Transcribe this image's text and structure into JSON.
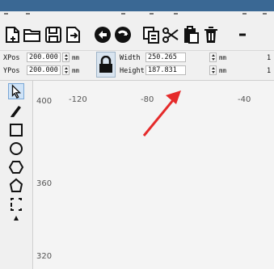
{
  "props": {
    "xpos_label": "XPos",
    "xpos_value": "200.000",
    "ypos_label": "YPos",
    "ypos_value": "200.000",
    "unit_mm": "mm",
    "width_label": "Width",
    "width_value": "250.265",
    "height_label": "Height",
    "height_value": "187.831",
    "right_cut_1": "1",
    "right_cut_2": "1"
  },
  "toolbar": {
    "buttons": [
      "new-file",
      "open-folder",
      "save",
      "import",
      "prev-circle",
      "next-circle",
      "copy",
      "cut",
      "paste",
      "delete"
    ]
  },
  "left_tools": [
    "select-arrow",
    "pen",
    "rectangle",
    "ellipse",
    "hexagon",
    "polygon",
    "text-frame"
  ],
  "canvas": {
    "ruler_x": [
      "-120",
      "-80",
      "-40"
    ],
    "ruler_y": [
      "400",
      "360",
      "320"
    ]
  },
  "colors": {
    "title_bar": "#3a6894",
    "annotation_arrow": "#e52b2b",
    "lock_bg": "#d9e4ef"
  }
}
